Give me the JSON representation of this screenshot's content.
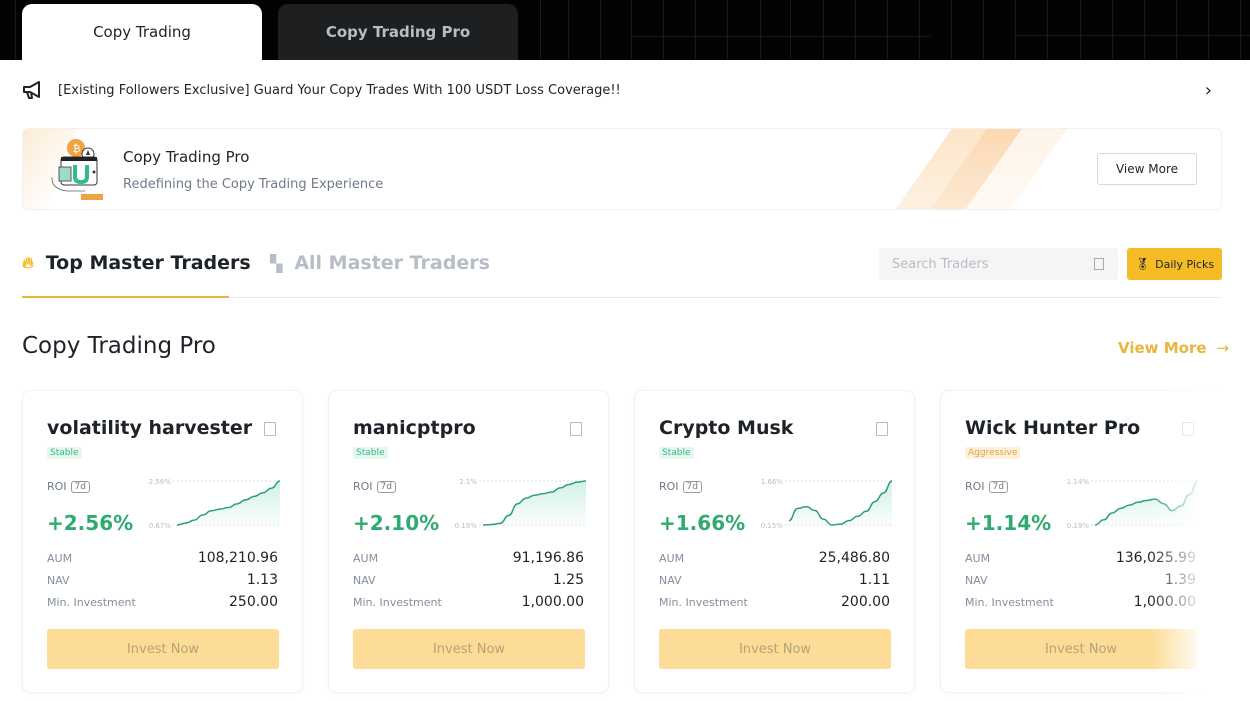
{
  "top_tabs": [
    {
      "label": "Copy Trading",
      "active": true
    },
    {
      "label": "Copy Trading Pro",
      "active": false
    }
  ],
  "announcement": {
    "icon": "megaphone-icon",
    "text": "[Existing Followers Exclusive] Guard Your Copy Trades With 100 USDT Loss Coverage!!"
  },
  "banner": {
    "title": "Copy Trading Pro",
    "subtitle": "Redefining the Copy Trading Experience",
    "button_label": "View More"
  },
  "trader_tabs": [
    {
      "label": "Top Master Traders",
      "icon": "fire-icon",
      "active": true
    },
    {
      "label": "All Master Traders",
      "icon": "grid-icon",
      "active": false
    }
  ],
  "search": {
    "placeholder": "Search Traders",
    "value": ""
  },
  "daily_picks_label": "Daily Picks",
  "section": {
    "title": "Copy Trading Pro",
    "view_more": "View More"
  },
  "labels": {
    "roi": "ROI",
    "period": "7d",
    "aum": "AUM",
    "nav": "NAV",
    "min_investment": "Min. Investment",
    "invest": "Invest Now"
  },
  "colors": {
    "accent": "#f5bc26",
    "positive": "#2eab6f",
    "stable": "#2ebd85",
    "aggressive": "#e7a33c"
  },
  "traders": [
    {
      "name": "volatility harvester",
      "risk": "Stable",
      "risk_type": "stable",
      "roi": "+2.56%",
      "roi_max_label": "2.56%",
      "roi_min_label": "0.67%",
      "roi_series": [
        0.67,
        0.75,
        0.88,
        1.1,
        1.28,
        1.35,
        1.42,
        1.58,
        1.75,
        1.9,
        2.05,
        2.25,
        2.56
      ],
      "aum": "108,210.96",
      "nav": "1.13",
      "min_investment": "250.00"
    },
    {
      "name": "manicptpro",
      "risk": "Stable",
      "risk_type": "stable",
      "roi": "+2.10%",
      "roi_max_label": "2.1%",
      "roi_min_label": "0.18%",
      "roi_series": [
        0.18,
        0.2,
        0.25,
        0.6,
        1.1,
        1.35,
        1.48,
        1.55,
        1.62,
        1.8,
        1.95,
        2.05,
        2.1
      ],
      "aum": "91,196.86",
      "nav": "1.25",
      "min_investment": "1,000.00"
    },
    {
      "name": "Crypto Musk",
      "risk": "Stable",
      "risk_type": "stable",
      "roi": "+1.66%",
      "roi_max_label": "1.66%",
      "roi_min_label": "0.15%",
      "roi_series": [
        0.3,
        0.72,
        0.78,
        0.65,
        0.35,
        0.15,
        0.18,
        0.3,
        0.45,
        0.62,
        0.95,
        1.25,
        1.66
      ],
      "aum": "25,486.80",
      "nav": "1.11",
      "min_investment": "200.00"
    },
    {
      "name": "Wick Hunter Pro",
      "risk": "Aggressive",
      "risk_type": "aggr",
      "roi": "+1.14%",
      "roi_max_label": "1.14%",
      "roi_min_label": "0.19%",
      "roi_series": [
        0.19,
        0.3,
        0.45,
        0.55,
        0.62,
        0.68,
        0.72,
        0.75,
        0.65,
        0.5,
        0.6,
        0.85,
        1.14
      ],
      "aum": "136,025.99",
      "nav": "1.39",
      "min_investment": "1,000.00"
    }
  ]
}
